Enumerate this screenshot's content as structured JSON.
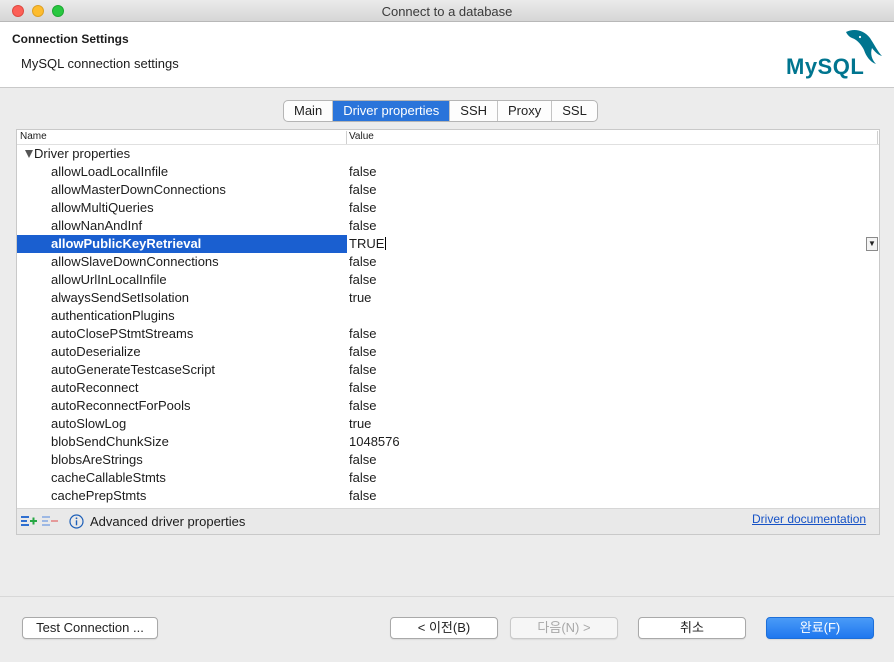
{
  "window": {
    "title": "Connect to a database"
  },
  "header": {
    "title": "Connection Settings",
    "subtitle": "MySQL connection settings",
    "logo_text": "MySQL"
  },
  "tabs": [
    {
      "label": "Main",
      "active": false
    },
    {
      "label": "Driver properties",
      "active": true
    },
    {
      "label": "SSH",
      "active": false
    },
    {
      "label": "Proxy",
      "active": false
    },
    {
      "label": "SSL",
      "active": false
    }
  ],
  "table": {
    "columns": {
      "name": "Name",
      "value": "Value"
    },
    "group": "Driver properties",
    "rows": [
      {
        "name": "allowLoadLocalInfile",
        "value": "false"
      },
      {
        "name": "allowMasterDownConnections",
        "value": "false"
      },
      {
        "name": "allowMultiQueries",
        "value": "false"
      },
      {
        "name": "allowNanAndInf",
        "value": "false"
      },
      {
        "name": "allowPublicKeyRetrieval",
        "value": "TRUE"
      },
      {
        "name": "allowSlaveDownConnections",
        "value": "false"
      },
      {
        "name": "allowUrlInLocalInfile",
        "value": "false"
      },
      {
        "name": "alwaysSendSetIsolation",
        "value": "true"
      },
      {
        "name": "authenticationPlugins",
        "value": ""
      },
      {
        "name": "autoClosePStmtStreams",
        "value": "false"
      },
      {
        "name": "autoDeserialize",
        "value": "false"
      },
      {
        "name": "autoGenerateTestcaseScript",
        "value": "false"
      },
      {
        "name": "autoReconnect",
        "value": "false"
      },
      {
        "name": "autoReconnectForPools",
        "value": "false"
      },
      {
        "name": "autoSlowLog",
        "value": "true"
      },
      {
        "name": "blobSendChunkSize",
        "value": "1048576"
      },
      {
        "name": "blobsAreStrings",
        "value": "false"
      },
      {
        "name": "cacheCallableStmts",
        "value": "false"
      },
      {
        "name": "cachePrepStmts",
        "value": "false"
      }
    ]
  },
  "footer": {
    "advanced_label": "Advanced driver properties",
    "doc_link": "Driver documentation"
  },
  "buttons": {
    "test_connection": "Test Connection ...",
    "back": "< 이전(B)",
    "next": "다음(N) >",
    "cancel": "취소",
    "finish": "완료(F)"
  },
  "colors": {
    "accent": "#2a74da",
    "selection": "#1a5fd0",
    "link": "#1652c6",
    "mysql_teal": "#00758f",
    "mysql_orange": "#f29111"
  }
}
